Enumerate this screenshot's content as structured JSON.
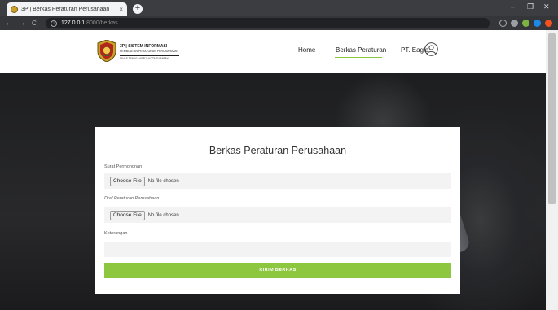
{
  "browser": {
    "tab_title": "3P | Berkas Peraturan Perusahaan",
    "tab_close": "×",
    "new_tab": "+",
    "url_host": "127.0.0.1",
    "url_rest": ":8000/berkas",
    "controls": {
      "minimize": "–",
      "restore": "❐",
      "close": "✕"
    },
    "nav": {
      "back": "←",
      "forward": "→",
      "reload": "C"
    }
  },
  "site": {
    "logo": {
      "line1": "3P | SISTEM INFORMASI",
      "line2": "PEMBUATAN PERATURAN PERUSAHAAN",
      "line3": "DINAS TENAGA KERJA KOTA SURABAYA"
    },
    "nav": {
      "home": "Home",
      "berkas": "Berkas Peraturan",
      "user": "PT. Eagle"
    },
    "accent_color": "#8dc63f"
  },
  "form": {
    "title": "Berkas Peraturan Perusahaan",
    "surat_label": "Surat Permohonan",
    "draf_label": "Draf Peraturan Perusahaan",
    "keterangan_label": "Keterangan",
    "choose_file": "Choose File",
    "no_file": "No file chosen",
    "keterangan_value": "",
    "submit": "KIRIM BERKAS"
  }
}
